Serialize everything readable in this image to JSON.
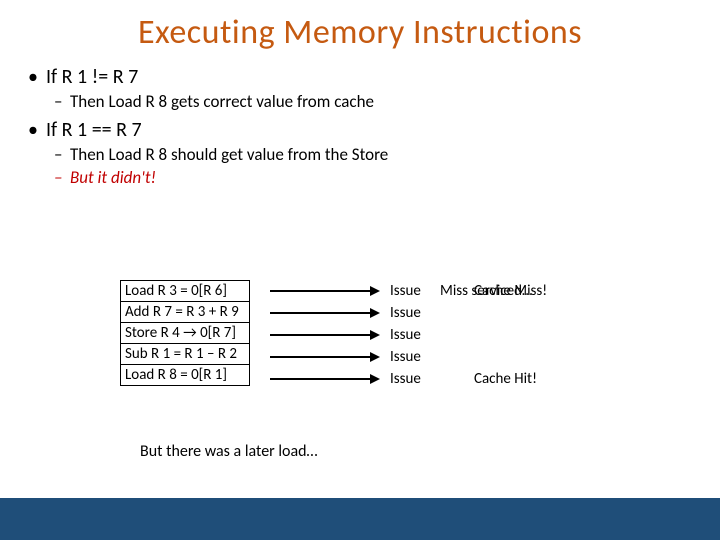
{
  "title": "Executing Memory Instructions",
  "bullets": {
    "b1": "If R 1 != R 7",
    "b1_sub1": "Then Load R 8 gets correct value from cache",
    "b2": "If R 1 == R 7",
    "b2_sub1": "Then Load R 8 should get value from the Store",
    "b2_sub2": "But it didn't!"
  },
  "instructions": [
    "Load R 3 = 0[R 6]",
    "Add R 7 = R 3 + R 9",
    "Store R 4 → 0[R 7]",
    "Sub R 1 = R 1 – R 2",
    "Load R 8 = 0[R 1]"
  ],
  "issue_label": "Issue",
  "annotations": {
    "row0": "Miss serviced…",
    "row0_overlap": "Cache Miss!",
    "row4": "Cache Hit!"
  },
  "caption": "But there was a later load…"
}
